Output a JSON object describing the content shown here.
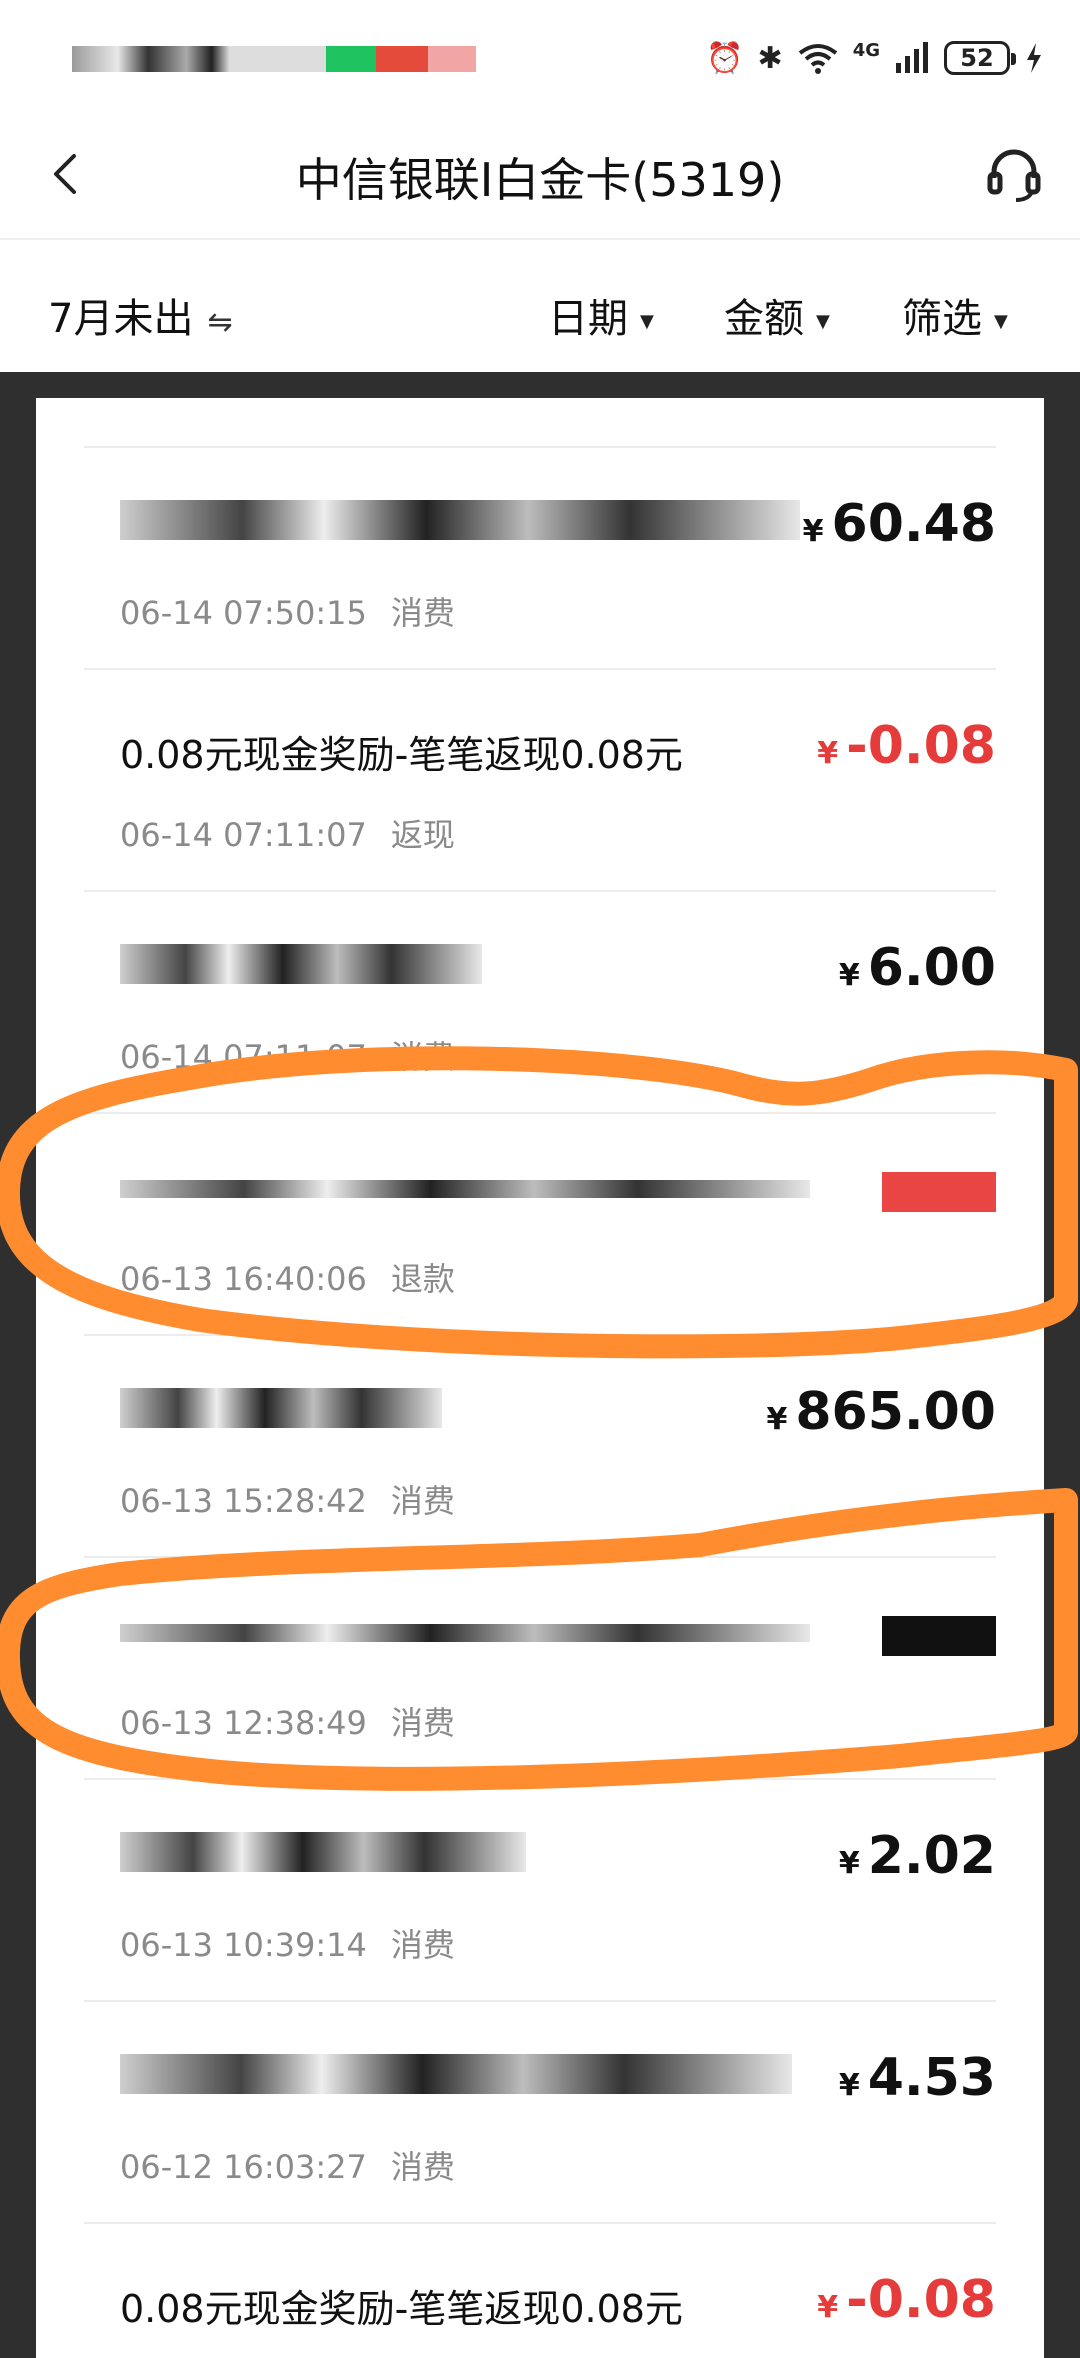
{
  "status_bar": {
    "battery": "52",
    "network": "4G",
    "icons": [
      "alarm-icon",
      "bluetooth-icon",
      "wifi-icon",
      "signal-icon",
      "charging-icon"
    ]
  },
  "header": {
    "title": "中信银联I白金卡(5319)",
    "back_icon": "chevron-left-icon",
    "support_icon": "headset-icon"
  },
  "filter_bar": {
    "month": "7月未出",
    "month_toggle": "⇋",
    "date": "日期",
    "amount": "金额",
    "filter": "筛选"
  },
  "transactions": [
    {
      "description": "",
      "time": "06-14 07:50:15",
      "type": "消费",
      "currency": "¥",
      "amount": "60.48"
    },
    {
      "description": "0.08元现金奖励-笔笔返现0.08元",
      "time": "06-14 07:11:07",
      "type": "返现",
      "currency": "¥",
      "amount": "-0.08"
    },
    {
      "description": "",
      "time": "06-14 07:11:07",
      "type": "消费",
      "currency": "¥",
      "amount": "6.00"
    },
    {
      "description": "",
      "time": "06-13 16:40:06",
      "type": "退款",
      "currency": "",
      "amount": ""
    },
    {
      "description": "",
      "time": "06-13 15:28:42",
      "type": "消费",
      "currency": "¥",
      "amount": "865.00"
    },
    {
      "description": "",
      "time": "06-13 12:38:49",
      "type": "消费",
      "currency": "",
      "amount": ""
    },
    {
      "description": "",
      "time": "06-13 10:39:14",
      "type": "消费",
      "currency": "¥",
      "amount": "2.02"
    },
    {
      "description": "",
      "time": "06-12 16:03:27",
      "type": "消费",
      "currency": "¥",
      "amount": "4.53"
    },
    {
      "description": "0.08元现金奖励-笔笔返现0.08元",
      "time": "",
      "type": "",
      "currency": "¥",
      "amount": "-0.08"
    }
  ],
  "colors": {
    "negative_amount": "#e53b3b",
    "highlight_stroke": "#ff8c2f",
    "backdrop": "#2f2f2f"
  }
}
